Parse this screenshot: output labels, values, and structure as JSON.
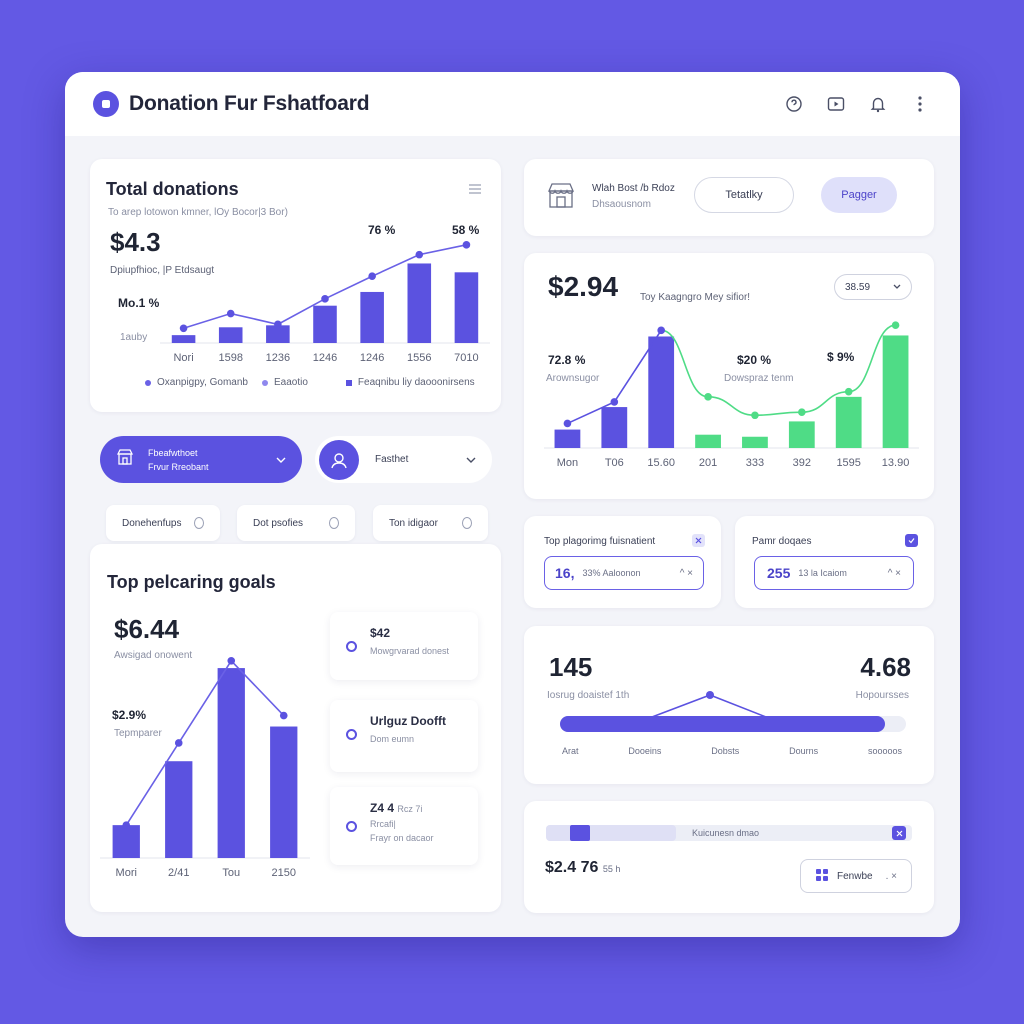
{
  "app": {
    "title": "Donation Fur Fshatfoard"
  },
  "colors": {
    "accent": "#5b52e0",
    "green": "#4fdc86",
    "background": "#6359e4"
  },
  "total_card": {
    "title": "Total donations",
    "subtitle": "To arep lotowon kmner, lOy Bocor|3 Bor)",
    "amount": "$4.3",
    "amount_label": "Dpiupfhioc, |P Etdsaugt",
    "pct_left": "Mo.1 %",
    "pct_top_1": "76 %",
    "pct_top_2": "58 %",
    "axis_low": "1auby",
    "legend": [
      "Oxanpigpy, Gomanb",
      "Eaaotio",
      "Feaqnibu liy daooonirsens"
    ]
  },
  "connect_card": {
    "text_1": "Wlah Bost /b Rdoz",
    "text_2": "Dhsaousnom",
    "button_1": "Tetatlky",
    "button_2": "Pagger"
  },
  "right_chart_card": {
    "amount": "$2.94",
    "subtitle": "Toy Kaagngro Mey sifior!",
    "select_value": "38.59",
    "pct_1": "72.8 %",
    "pct_1_label": "Arownsugor",
    "pct_2": "$20 %",
    "pct_2_label": "Dowspraz tenm",
    "pct_3": "$ 9%"
  },
  "selectors": {
    "primary_line1": "Fbeafwthoet",
    "primary_line2": "Frvur Rreobant",
    "secondary_label": "Fasthet"
  },
  "chips": [
    "Donehenfups",
    "Dot psofies",
    "Ton idigaor"
  ],
  "goals_card": {
    "title": "Top pelcaring goals",
    "amount": "$6.44",
    "amount_label": "Awsigad onowent",
    "pct": "$2.9%",
    "pct_label": "Tepmparer"
  },
  "goals": [
    {
      "title": "$42",
      "sub": "Mowgrvarad donest"
    },
    {
      "title": "Urlguz Doofft",
      "sub": "Dom eumn"
    },
    {
      "title": "Z4 4",
      "title_suffix": "Rcz 7i",
      "sub": "Rrcafi|",
      "sub2": "Frayr on dacaor"
    }
  ],
  "mini_cards": [
    {
      "label": "Top plagorimg fuisnatient",
      "value": "16,",
      "value_suffix": "33% Aaloonon"
    },
    {
      "label": "Pamr doqaes",
      "value": "255",
      "value_suffix": "13 la Icaiom"
    }
  ],
  "range_card": {
    "left_value": "145",
    "left_label": "Iosrug doaistef 1th",
    "right_value": "4.68",
    "right_label": "Hopoursses",
    "axis": [
      "Arat",
      "Dooeins",
      "Dobsts",
      "Dourns",
      "sooooos"
    ],
    "fill_fraction": 0.94
  },
  "bottom_card": {
    "progress_label": "Kuicunesn dmao",
    "amount": "$2.4 76",
    "amount_suffix": "55 h",
    "button": "Fenwbe"
  },
  "chart_data": [
    {
      "type": "bar",
      "categories": [
        "Nori",
        "1598",
        "1236",
        "1246",
        "1246",
        "1556",
        "7010"
      ],
      "values": [
        0.8,
        1.6,
        1.8,
        3.8,
        5.2,
        8.1,
        7.2
      ],
      "line": [
        1.5,
        3.0,
        1.9,
        4.5,
        6.8,
        9.0,
        10.0
      ],
      "ylim": [
        0,
        11
      ]
    },
    {
      "type": "bar",
      "categories": [
        "Mon",
        "T06",
        "15.60",
        "201",
        "333",
        "392",
        "1595",
        "13.90"
      ],
      "values": [
        1.8,
        4.0,
        10.9,
        1.3,
        1.1,
        2.6,
        5.0,
        11.0
      ],
      "line": [
        2.4,
        4.5,
        11.5,
        5.0,
        3.2,
        3.5,
        5.5,
        12.0
      ],
      "bar_colors": [
        "#5b52e0",
        "#5b52e0",
        "#5b52e0",
        "#4fdc86",
        "#4fdc86",
        "#4fdc86",
        "#4fdc86",
        "#4fdc86"
      ],
      "ylim": [
        0,
        13
      ]
    },
    {
      "type": "bar",
      "categories": [
        "Mori",
        "2/41",
        "Tou",
        "2150"
      ],
      "values": [
        1.8,
        5.3,
        10.4,
        7.2
      ],
      "line": [
        1.8,
        6.3,
        10.8,
        7.8
      ],
      "ylim": [
        0,
        11.5
      ]
    }
  ]
}
